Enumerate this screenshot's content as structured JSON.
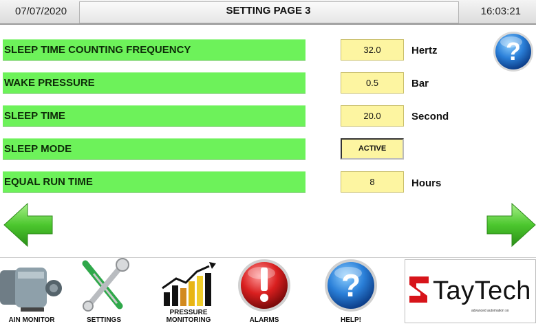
{
  "header": {
    "date": "07/07/2020",
    "title": "SETTING PAGE 3",
    "time": "16:03:21"
  },
  "settings": [
    {
      "label": "SLEEP TIME COUNTING FREQUENCY",
      "value": "32.0",
      "unit": "Hertz"
    },
    {
      "label": "WAKE PRESSURE",
      "value": "0.5",
      "unit": "Bar"
    },
    {
      "label": "SLEEP TIME",
      "value": "20.0",
      "unit": "Second"
    },
    {
      "label": "SLEEP MODE",
      "value": "ACTIVE",
      "unit": ""
    },
    {
      "label": "EQUAL RUN TIME",
      "value": "8",
      "unit": "Hours"
    }
  ],
  "nav": {
    "main_monitor": "AIN MONITOR",
    "settings": "SETTINGS",
    "pressure_line1": "PRESSURE",
    "pressure_line2": "MONITORING",
    "alarms": "ALARMS",
    "help": "HELP!"
  },
  "logo": {
    "name": "TayTech",
    "tagline": "advanced automation so"
  },
  "colors": {
    "label_green": "#6df25a",
    "value_yellow": "#fdf5a1",
    "arrow_green": "#4cc72e",
    "help_blue": "#1f6fc9",
    "alarm_red": "#d91f1f",
    "logo_red": "#d7141a"
  }
}
